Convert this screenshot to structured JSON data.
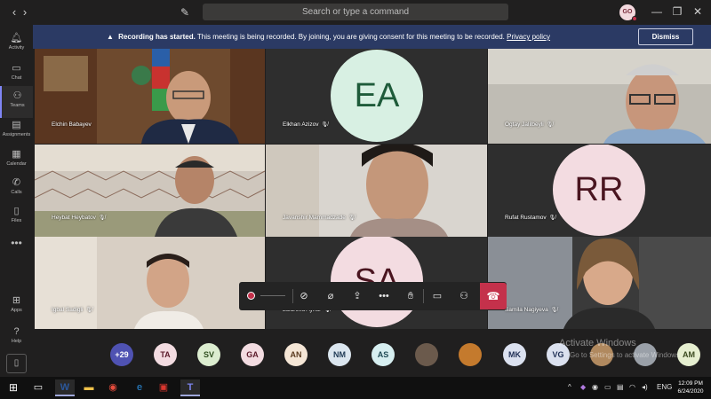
{
  "titlebar": {
    "back_icon": "chevron-left-icon",
    "forward_icon": "chevron-right-icon",
    "compose_icon": "compose-icon",
    "search_placeholder": "Search or type a command",
    "user_initials": "GO",
    "minimize_icon": "minimize-icon",
    "maximize_icon": "maximize-icon",
    "close_icon": "close-icon"
  },
  "rail": {
    "items": [
      {
        "label": "Activity",
        "icon": "bell-icon"
      },
      {
        "label": "Chat",
        "icon": "chat-icon"
      },
      {
        "label": "Teams",
        "icon": "teams-icon",
        "active": true
      },
      {
        "label": "Assignments",
        "icon": "assignments-icon"
      },
      {
        "label": "Calendar",
        "icon": "calendar-icon"
      },
      {
        "label": "Calls",
        "icon": "phone-icon"
      },
      {
        "label": "Files",
        "icon": "files-icon"
      }
    ],
    "more": "•••",
    "bottom_items": [
      {
        "label": "Apps",
        "icon": "apps-icon"
      },
      {
        "label": "Help",
        "icon": "help-icon"
      }
    ]
  },
  "banner": {
    "title": "Recording has started.",
    "message": "This meeting is being recorded. By joining, you are giving consent for this meeting to be recorded.",
    "link": "Privacy policy",
    "dismiss": "Dismiss"
  },
  "participants": [
    {
      "name": "Elchin Babayev",
      "type": "video"
    },
    {
      "name": "Elkhan Azizov",
      "type": "initials",
      "initials": "EA",
      "color": "#d8f0e3",
      "text_color": "#1e5b3a"
    },
    {
      "name": "Ogtay Jalilbeyli",
      "type": "video"
    },
    {
      "name": "Heybat Heybatov",
      "type": "video"
    },
    {
      "name": "Javanshir Mammadzade",
      "type": "video"
    },
    {
      "name": "Rufat Rustamov",
      "type": "initials",
      "initials": "RR",
      "color": "#f3dce1",
      "text_color": "#4a1520"
    },
    {
      "name": "Igbal Sadigli",
      "type": "video"
    },
    {
      "name": "Jafarova Aynur",
      "type": "initials",
      "initials": "SA",
      "color": "#f3dce1",
      "text_color": "#4a1520"
    },
    {
      "name": "Samila Nagiyeva",
      "type": "video"
    }
  ],
  "call_toolbar": {
    "buttons": [
      "video-off-icon",
      "mic-off-icon",
      "share-screen-icon",
      "more-actions-icon",
      "raise-hand-icon",
      "chat-icon",
      "participants-icon"
    ],
    "hangup_icon": "hang-up-icon"
  },
  "roster": [
    {
      "label": "+29",
      "color": "#4f52b2",
      "text_color": "#ffffff"
    },
    {
      "label": "TA",
      "color": "#f3dce1",
      "text_color": "#5c1b2b"
    },
    {
      "label": "SV",
      "color": "#dcedd0",
      "text_color": "#2f4f1f"
    },
    {
      "label": "GA",
      "color": "#f3dce1",
      "text_color": "#5c1b2b"
    },
    {
      "label": "AN",
      "color": "#f5e6d6",
      "text_color": "#5a3a1f"
    },
    {
      "label": "NM",
      "color": "#dbe6ef",
      "text_color": "#1f3a55"
    },
    {
      "label": "AS",
      "color": "#d6eef0",
      "text_color": "#1f4a55"
    },
    {
      "label": "",
      "color": "#6b5a4c",
      "text_color": "#ffffff",
      "photo": true
    },
    {
      "label": "",
      "color": "#c47a2d",
      "text_color": "#ffffff",
      "photo": true
    },
    {
      "label": "MK",
      "color": "#dbe1ef",
      "text_color": "#1f2f55"
    },
    {
      "label": "VG",
      "color": "#dbe1ef",
      "text_color": "#1f2f55"
    },
    {
      "label": "",
      "color": "#b0895f",
      "text_color": "#ffffff",
      "photo": true
    },
    {
      "label": "",
      "color": "#9aa0a8",
      "text_color": "#ffffff",
      "photo": true
    },
    {
      "label": "AM",
      "color": "#e6efd0",
      "text_color": "#3a4a1f"
    }
  ],
  "watermark": {
    "line1": "Activate Windows",
    "line2": "Go to Settings to activate Windows."
  },
  "taskbar": {
    "apps": [
      "windows-start-icon",
      "task-view-icon",
      "word-icon",
      "file-explorer-icon",
      "chrome-icon",
      "edge-icon",
      "camera-app-icon",
      "teams-icon"
    ],
    "tray_language": "ENG",
    "time": "12:09 PM",
    "date": "6/24/2020"
  }
}
